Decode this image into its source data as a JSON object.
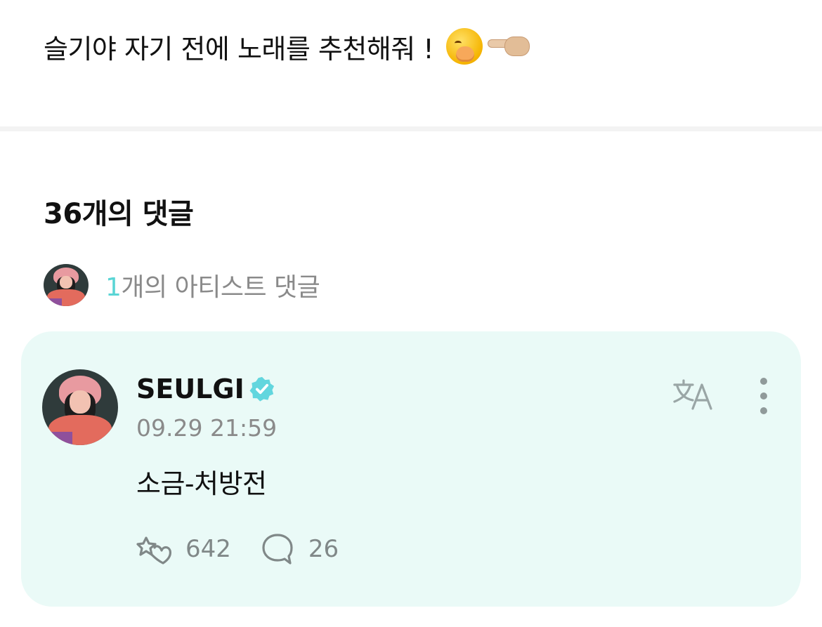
{
  "post": {
    "text": "슬기야 자기 전에 노래를 추천해줘 !",
    "emojis": [
      "yawning-face",
      "pointing-hand"
    ]
  },
  "comments": {
    "count_label": "36개의 댓글",
    "artist_summary": {
      "count": "1",
      "label": "개의 아티스트 댓글"
    }
  },
  "comment": {
    "author": "SEULGI",
    "verified": true,
    "timestamp": "09.29 21:59",
    "body": "소금-처방전",
    "likes": "642",
    "replies": "26",
    "icons": {
      "translate": "translate-icon",
      "more": "more-vertical-icon",
      "like": "heart-cheer-icon",
      "reply": "speech-bubble-icon"
    }
  },
  "colors": {
    "accent": "#5ad5d5",
    "card_bg": "#eafaf7",
    "muted_text": "#8a8a8a"
  }
}
